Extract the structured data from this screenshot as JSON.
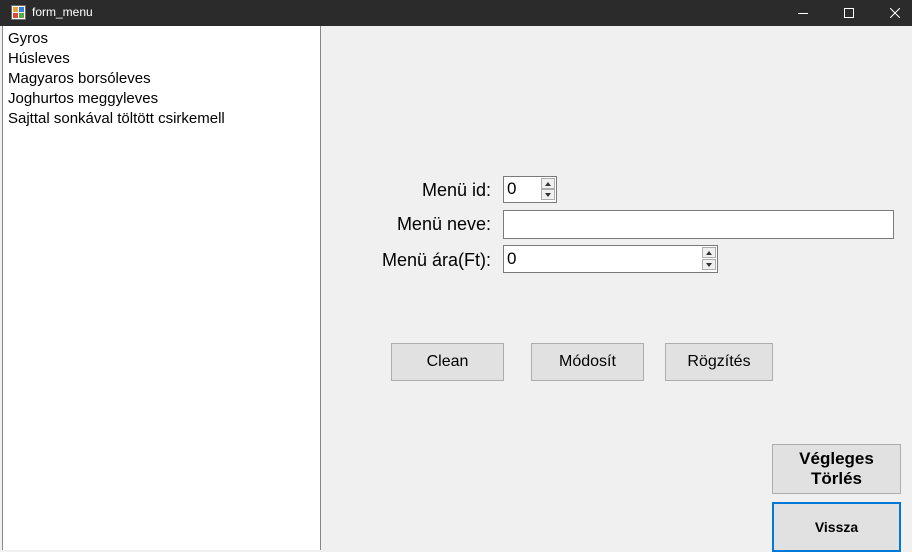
{
  "window": {
    "title": "form_menu"
  },
  "menu_list": {
    "items": [
      "Gyros",
      "Húsleves",
      "Magyaros borsóleves",
      "Joghurtos meggyleves",
      "Sajttal sonkával töltött csirkemell"
    ]
  },
  "form": {
    "id_label": "Menü id:",
    "id_value": "0",
    "name_label": "Menü neve:",
    "name_value": "",
    "price_label": "Menü ára(Ft):",
    "price_value": "0"
  },
  "buttons": {
    "clean": "Clean",
    "modify": "Módosít",
    "save": "Rögzítés",
    "delete_line1": "Végleges",
    "delete_line2": "Törlés",
    "back": "Vissza"
  }
}
